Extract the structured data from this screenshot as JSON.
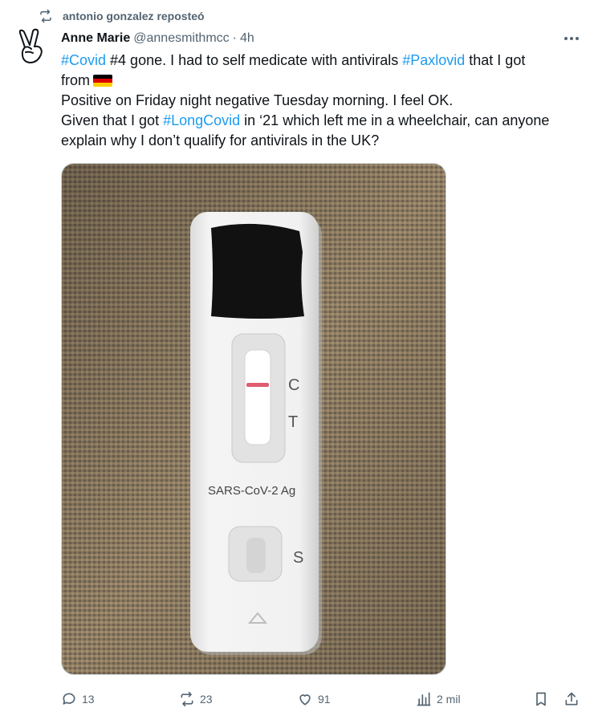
{
  "repost": {
    "label": "antonio gonzalez reposteó",
    "icon": "repost-icon"
  },
  "tweet": {
    "author_name": "Anne Marie",
    "author_handle": "@annesmithmcc",
    "separator": "·",
    "time": "4h",
    "avatar_icon": "peace-hand-icon",
    "body": {
      "line1_tag1": "#Covid",
      "line1_text1": " #4 gone. I had to self medicate with antivirals ",
      "line1_tag2": "#Paxlovid",
      "line1_text2": " that I got",
      "line2_text": "from",
      "line3_text": "Positive on Friday night negative Tuesday morning. I feel OK.",
      "line4_text1": "Given that I got ",
      "line4_tag": "#LongCovid",
      "line4_text2": " in ‘21 which left me in a wheelchair, can anyone",
      "line5_text": "explain why I don’t qualify for antivirals in the UK?"
    },
    "flag_colors": [
      "#000000",
      "#dd0000",
      "#ffce00"
    ],
    "media": {
      "label_c": "C",
      "label_t": "T",
      "label_s": "S",
      "test_name": "SARS-CoV-2 Ag",
      "control_line_color": "#e05c70"
    }
  },
  "actions": {
    "replies": "13",
    "reposts": "23",
    "likes": "91",
    "views": "2 mil"
  },
  "colors": {
    "accent": "#1d9bf0",
    "muted": "#536471",
    "text": "#0f1419"
  }
}
